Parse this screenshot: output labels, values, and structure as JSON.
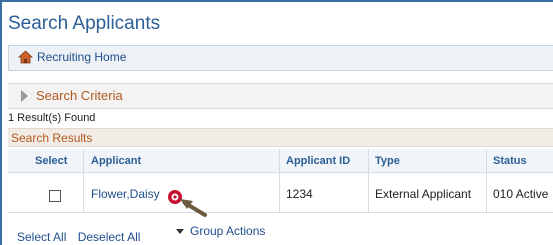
{
  "page": {
    "title": "Search Applicants"
  },
  "home": {
    "label": "Recruiting Home",
    "icon": "home-icon"
  },
  "criteria": {
    "label": "Search Criteria",
    "icon": "expand-triangle-icon"
  },
  "results": {
    "count_text": "1 Result(s) Found",
    "title": "Search Results",
    "columns": [
      "Select",
      "Applicant",
      "Applicant ID",
      "Type",
      "Status"
    ],
    "rows": [
      {
        "selected": false,
        "applicant": "Flower,Daisy",
        "applicant_id": "1234",
        "type": "External Applicant",
        "status": "010 Active"
      }
    ]
  },
  "footer": {
    "select_all": "Select All",
    "deselect_all": "Deselect All",
    "group_actions": "Group Actions"
  },
  "colors": {
    "link": "#1f4e8c",
    "accent": "#b4581f",
    "title": "#2b5f97",
    "pointer": "#c8102e"
  }
}
